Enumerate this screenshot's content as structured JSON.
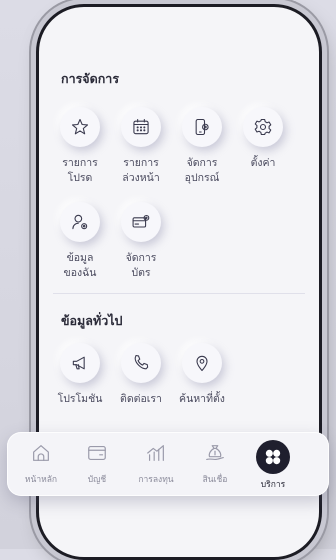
{
  "sections": {
    "manage": {
      "title": "การจัดการ",
      "items": [
        {
          "label": "รายการ\nโปรด",
          "icon": "star-icon"
        },
        {
          "label": "รายการ\nล่วงหน้า",
          "icon": "calendar-icon"
        },
        {
          "label": "จัดการ\nอุปกรณ์",
          "icon": "device-settings-icon"
        },
        {
          "label": "ตั้งค่า",
          "icon": "gear-icon"
        },
        {
          "label": "ข้อมูล\nของฉัน",
          "icon": "user-settings-icon"
        },
        {
          "label": "จัดการ\nบัตร",
          "icon": "card-settings-icon"
        }
      ]
    },
    "general": {
      "title": "ข้อมูลทั่วไป",
      "items": [
        {
          "label": "โปรโมชัน",
          "icon": "megaphone-icon"
        },
        {
          "label": "ติดต่อเรา",
          "icon": "phone-icon"
        },
        {
          "label": "ค้นหาที่ตั้ง",
          "icon": "location-pin-icon"
        }
      ]
    }
  },
  "tabbar": {
    "active_index": 4,
    "tabs": [
      {
        "label": "หน้าหลัก",
        "icon": "home-icon"
      },
      {
        "label": "บัญชี",
        "icon": "wallet-icon"
      },
      {
        "label": "การลงทุน",
        "icon": "investment-chart-icon"
      },
      {
        "label": "สินเชื่อ",
        "icon": "loan-money-bag-icon"
      },
      {
        "label": "บริการ",
        "icon": "services-grid-icon"
      }
    ]
  }
}
